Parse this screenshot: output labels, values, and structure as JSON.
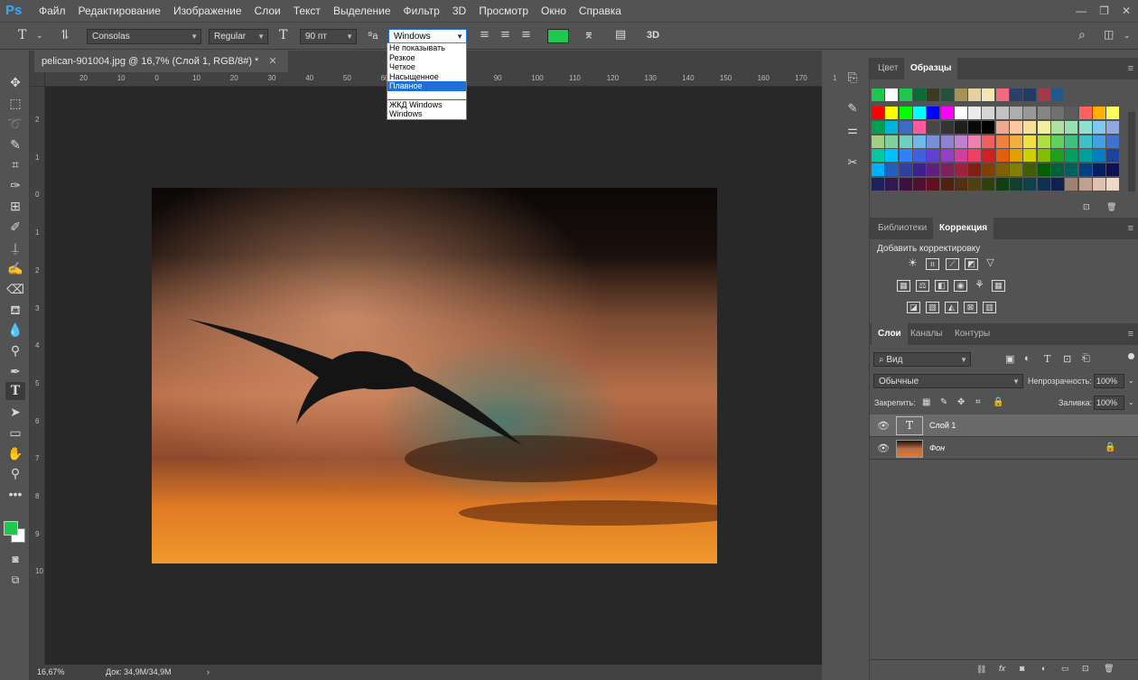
{
  "menubar": {
    "logo": "Ps",
    "items": [
      "Файл",
      "Редактирование",
      "Изображение",
      "Слои",
      "Текст",
      "Выделение",
      "Фильтр",
      "3D",
      "Просмотр",
      "Окно",
      "Справка"
    ]
  },
  "options": {
    "font_family": "Consolas",
    "font_style": "Regular",
    "font_size": "90 пт",
    "antialias": "Windows",
    "antialias_options": [
      "Не показывать",
      "Резкое",
      "Четкое",
      "Насыщенное",
      "Плавное",
      "ЖКД Windows",
      "Windows"
    ],
    "antialias_selected": "Плавное",
    "text_color": "#1ec850",
    "aa_label": "ªa",
    "threed_label": "3D"
  },
  "document": {
    "tab_title": "pelican-901004.jpg @ 16,7% (Слой 1, RGB/8#) *",
    "ruler_labels": [
      "20",
      "10",
      "0",
      "10",
      "20",
      "30",
      "40",
      "50",
      "60",
      "70",
      "80",
      "90",
      "100",
      "110",
      "120",
      "130",
      "140",
      "150",
      "160",
      "170",
      "180",
      "190"
    ],
    "vruler_labels": [
      "2",
      "1",
      "0",
      "1",
      "2",
      "3",
      "4",
      "5",
      "6",
      "7",
      "8",
      "9",
      "10"
    ],
    "zoom": "16,67%",
    "doc_size": "Док: 34,9M/34,9M"
  },
  "colors_panel": {
    "tabs": [
      "Цвет",
      "Образцы"
    ],
    "active_tab": "Образцы"
  },
  "adjustments_panel": {
    "tabs": [
      "Библиотеки",
      "Коррекция"
    ],
    "active_tab": "Коррекция",
    "heading": "Добавить корректировку"
  },
  "layers_panel": {
    "tabs": [
      "Слои",
      "Каналы",
      "Контуры"
    ],
    "active_tab": "Слои",
    "filter_label": "Вид",
    "blend_mode": "Обычные",
    "opacity_label": "Непрозрачность:",
    "opacity_value": "100%",
    "lock_label": "Закрепить:",
    "fill_label": "Заливка:",
    "fill_value": "100%",
    "layers": [
      {
        "name": "Слой 1",
        "type": "text",
        "selected": true
      },
      {
        "name": "Фон",
        "type": "image",
        "locked": true
      }
    ]
  },
  "colors": {
    "foreground": "#1ec850",
    "background": "#ffffff",
    "accent": "#31a8ff"
  }
}
